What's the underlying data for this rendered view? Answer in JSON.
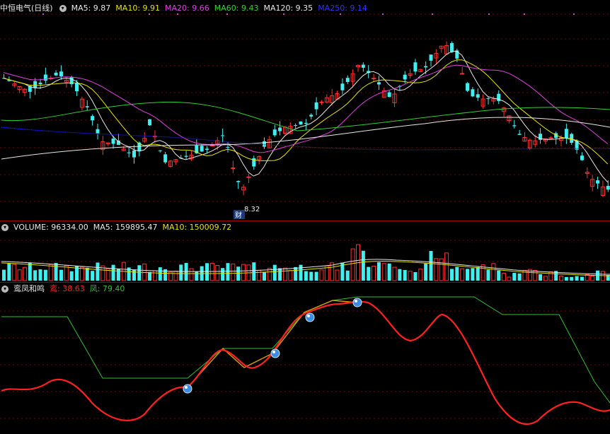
{
  "price_panel": {
    "title": "中恒电气(日线)",
    "indicators": [
      {
        "label": "MA5: 9.87",
        "color": "#e8e8e8"
      },
      {
        "label": "MA10: 9.91",
        "color": "#e6e600"
      },
      {
        "label": "MA20: 9.66",
        "color": "#e040e0"
      },
      {
        "label": "MA60: 9.43",
        "color": "#30d030"
      },
      {
        "label": "MA120: 9.35",
        "color": "#e8e8e8"
      },
      {
        "label": "MA250: 9.14",
        "color": "#2020ff"
      }
    ],
    "low_marker": "8.32",
    "event_tag": "财"
  },
  "volume_panel": {
    "indicators": [
      {
        "label": "VOLUME: 96334.00",
        "color": "#e8e8e8"
      },
      {
        "label": "MA5: 159895.47",
        "color": "#e8e8e8"
      },
      {
        "label": "MA10: 150009.72",
        "color": "#e6e600"
      }
    ]
  },
  "indicator_panel": {
    "title": "鸾凤和鸣",
    "values": [
      {
        "label": "鸾: 38.63",
        "color": "#ff2020"
      },
      {
        "label": "凤: 79.40",
        "color": "#30c030"
      }
    ]
  },
  "colors": {
    "up": "#ff3030",
    "down": "#40f0f0",
    "grid": "#7a0000"
  }
}
